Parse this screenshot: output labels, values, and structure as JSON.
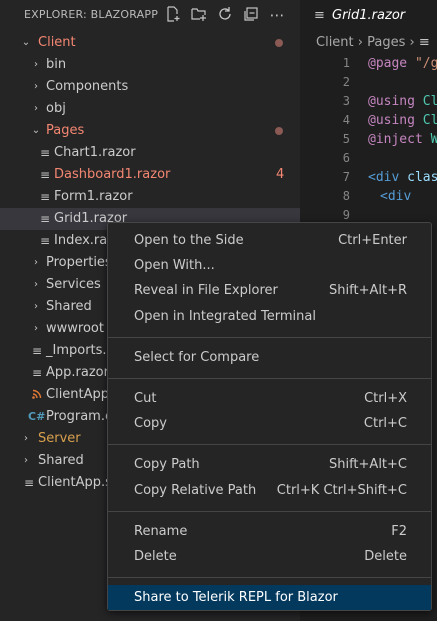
{
  "explorer": {
    "title": "EXPLORER: BLAZORAPP",
    "toolbar_icons": [
      "new-file-icon",
      "new-folder-icon",
      "refresh-icon",
      "collapse-all-icon",
      "more-icon"
    ],
    "tree": [
      {
        "label": "Client",
        "badge": ""
      },
      {
        "label": "bin"
      },
      {
        "label": "Components"
      },
      {
        "label": "obj"
      },
      {
        "label": "Pages"
      },
      {
        "label": "Chart1.razor"
      },
      {
        "label": "Dashboard1.razor",
        "badge": "4"
      },
      {
        "label": "Form1.razor"
      },
      {
        "label": "Grid1.razor"
      },
      {
        "label": "Index.razor"
      },
      {
        "label": "Properties"
      },
      {
        "label": "Services"
      },
      {
        "label": "Shared"
      },
      {
        "label": "wwwroot"
      },
      {
        "label": "_Imports.razor"
      },
      {
        "label": "App.razor"
      },
      {
        "label": "ClientApp.csproj"
      },
      {
        "label": "Program.cs"
      },
      {
        "label": "Server"
      },
      {
        "label": "Shared"
      },
      {
        "label": "ClientApp.sln"
      }
    ]
  },
  "editor": {
    "tab_label": "Grid1.razor",
    "breadcrumb": [
      "Client",
      "Pages"
    ],
    "line_numbers": [
      "1",
      "2",
      "3",
      "4",
      "5",
      "6",
      "7",
      "8",
      "9"
    ],
    "lines": {
      "l1_kw": "@page",
      "l1_str": "\"/g",
      "l3_kw": "@using",
      "l3_ns": "Cl",
      "l4_kw": "@using",
      "l4_ns": "Cl",
      "l5_kw": "@inject",
      "l5_ns": "W",
      "l7_tag": "<div",
      "l7_attr": "clas",
      "l8_tag": "<div"
    }
  },
  "context_menu": {
    "items": [
      {
        "label": "Open to the Side",
        "key": "Ctrl+Enter"
      },
      {
        "label": "Open With...",
        "key": ""
      },
      {
        "label": "Reveal in File Explorer",
        "key": "Shift+Alt+R"
      },
      {
        "label": "Open in Integrated Terminal",
        "key": ""
      },
      {
        "label": "Select for Compare",
        "key": ""
      },
      {
        "label": "Cut",
        "key": "Ctrl+X"
      },
      {
        "label": "Copy",
        "key": "Ctrl+C"
      },
      {
        "label": "Copy Path",
        "key": "Shift+Alt+C"
      },
      {
        "label": "Copy Relative Path",
        "key": "Ctrl+K Ctrl+Shift+C"
      },
      {
        "label": "Rename",
        "key": "F2"
      },
      {
        "label": "Delete",
        "key": "Delete"
      },
      {
        "label": "Share to Telerik REPL for Blazor",
        "key": ""
      }
    ]
  },
  "colors": {
    "git_modified": "#f48771",
    "folder_orange": "#d7a04d",
    "menu_active": "#04395e"
  }
}
